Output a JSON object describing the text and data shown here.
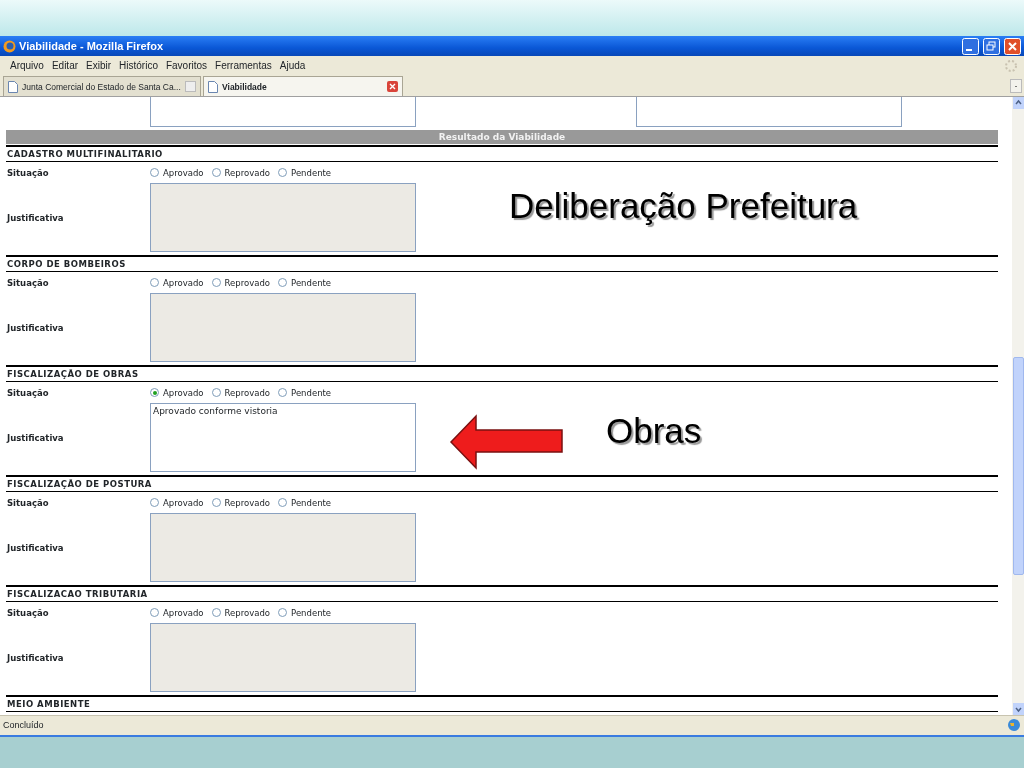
{
  "window": {
    "title": "Viabilidade - Mozilla Firefox"
  },
  "menu": [
    "Arquivo",
    "Editar",
    "Exibir",
    "Histórico",
    "Favoritos",
    "Ferramentas",
    "Ajuda"
  ],
  "tabs": [
    {
      "label": "Junta Comercial do Estado de Santa Ca...",
      "selected": false
    },
    {
      "label": "Viabilidade",
      "selected": true
    }
  ],
  "result_header": "Resultado da Viabilidade",
  "sections": [
    {
      "title": "CADASTRO MULTIFINALITARIO",
      "situation_label": "Situação",
      "options": [
        {
          "label": "Aprovado",
          "selected": false
        },
        {
          "label": "Reprovado",
          "selected": false
        },
        {
          "label": "Pendente",
          "selected": false
        }
      ],
      "justification_label": "Justificativa"
    },
    {
      "title": "CORPO DE BOMBEIROS",
      "situation_label": "Situação",
      "options": [
        {
          "label": "Aprovado",
          "selected": false
        },
        {
          "label": "Reprovado",
          "selected": false
        },
        {
          "label": "Pendente",
          "selected": false
        }
      ],
      "justification_label": "Justificativa"
    },
    {
      "title": "FISCALIZAÇÃO DE OBRAS",
      "situation_label": "Situação",
      "options": [
        {
          "label": "Aprovado",
          "selected": true
        },
        {
          "label": "Reprovado",
          "selected": false
        },
        {
          "label": "Pendente",
          "selected": false
        }
      ],
      "justification_label": "Justificativa",
      "justification": "Aprovado conforme vistoria"
    },
    {
      "title": "FISCALIZAÇÃO DE POSTURA",
      "situation_label": "Situação",
      "options": [
        {
          "label": "Aprovado",
          "selected": false
        },
        {
          "label": "Reprovado",
          "selected": false
        },
        {
          "label": "Pendente",
          "selected": false
        }
      ],
      "justification_label": "Justificativa"
    },
    {
      "title": "FISCALIZACAO TRIBUTARIA",
      "situation_label": "Situação",
      "options": [
        {
          "label": "Aprovado",
          "selected": false
        },
        {
          "label": "Reprovado",
          "selected": false
        },
        {
          "label": "Pendente",
          "selected": false
        }
      ],
      "justification_label": "Justificativa"
    },
    {
      "title": "MEIO AMBIENTE"
    }
  ],
  "status_bar": "Concluído",
  "annotations": [
    {
      "kind": "label",
      "text": "Deliberação Prefeitura"
    },
    {
      "kind": "label",
      "text": "Obras"
    },
    {
      "kind": "arrow"
    }
  ]
}
